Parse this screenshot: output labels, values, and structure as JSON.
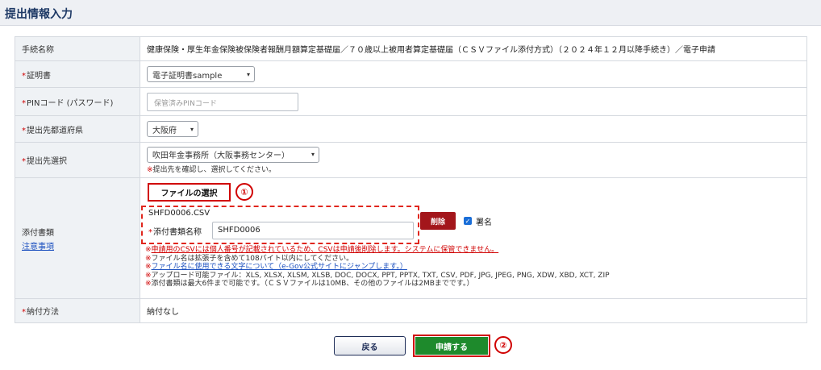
{
  "header": {
    "title": "提出情報入力"
  },
  "rows": {
    "procedure": {
      "label": "手続名称",
      "value": "健康保険・厚生年金保険被保険者報酬月額算定基礎届／７０歳以上被用者算定基礎届（ＣＳＶファイル添付方式）（２０２４年１２月以降手続き）／電子申請"
    },
    "certificate": {
      "required_mark": "*",
      "label": "証明書",
      "selected": "電子証明書sample"
    },
    "pin": {
      "required_mark": "*",
      "label": "PINコード (パスワード)",
      "placeholder": "保管済みPINコード"
    },
    "prefecture": {
      "required_mark": "*",
      "label": "提出先都道府県",
      "selected": "大阪府"
    },
    "destination": {
      "required_mark": "*",
      "label": "提出先選択",
      "selected": "吹田年金事務所（大阪事務センター）",
      "note_mark": "※",
      "note": "提出先を確認し、選択してください。"
    },
    "attachment": {
      "label": "添付書類",
      "link": "注意事項",
      "file_button": "ファイルの選択",
      "annotation_1": "①",
      "file_name": "SHFD0006.CSV",
      "name_required_mark": "*",
      "name_label": "添付書類名称",
      "name_value": "SHFD0006",
      "delete_button": "削除",
      "sign_label": "署名",
      "checkbox_mark": "✓",
      "notes": [
        {
          "mark": "※",
          "text": "申請用のCSVには個人番号が記載されているため、CSVは申請後削除します。システムに保管できません。"
        },
        {
          "mark": "※",
          "text": "ファイル名は拡張子を含めて108バイト以内にしてください。"
        },
        {
          "mark": "※",
          "text": "ファイル名に使用できる文字について（e-Gov公式サイトにジャンプします。）"
        },
        {
          "mark": "※",
          "text": "アップロード可能ファイル：XLS, XLSX, XLSM, XLSB, DOC, DOCX, PPT, PPTX, TXT, CSV, PDF, JPG, JPEG, PNG, XDW, XBD, XCT, ZIP"
        },
        {
          "mark": "※",
          "text": "添付書類は最大6件まで可能です。（ＣＳＶファイルは10MB、その他のファイルは2MBまでです。）"
        }
      ]
    },
    "payment": {
      "required_mark": "*",
      "label": "納付方法",
      "value": "納付なし"
    }
  },
  "buttons": {
    "back": "戻る",
    "submit": "申請する",
    "annotation_2": "②"
  },
  "icons": {
    "dropdown": "▾"
  },
  "colors": {
    "required": "#d00000",
    "submit": "#1e8a2c",
    "delete": "#a3161b",
    "header_title": "#1f3a66"
  }
}
